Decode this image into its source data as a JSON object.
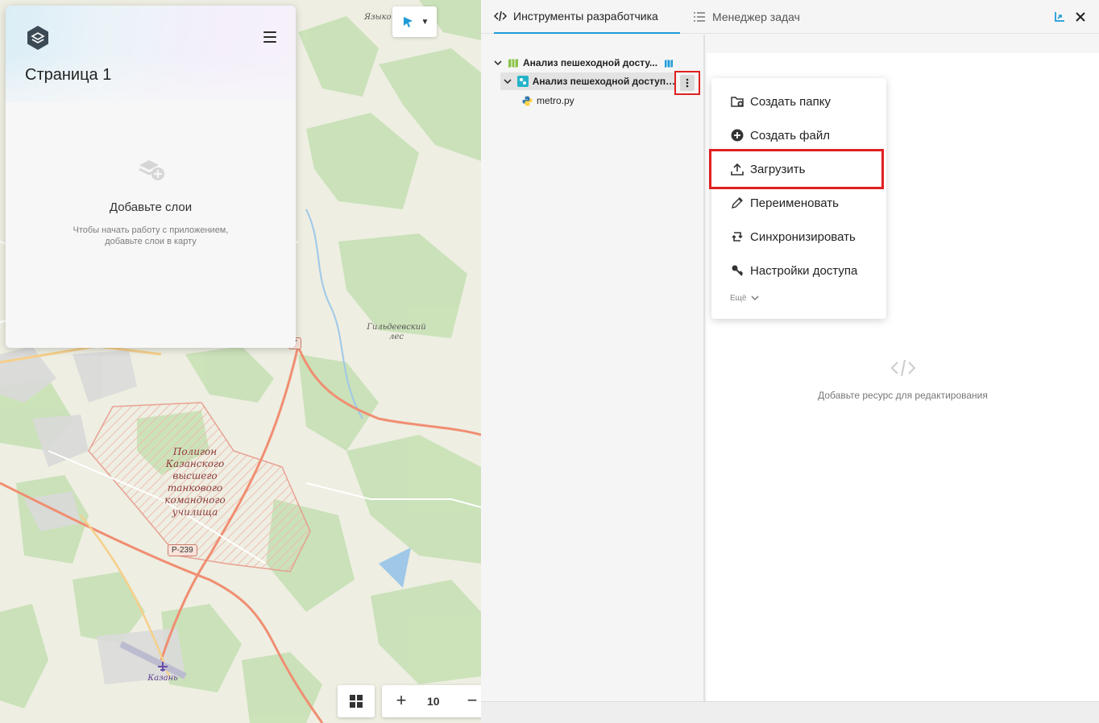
{
  "map": {
    "labels": {
      "polygon": "Полигон Казанского высшего танкового командного училища",
      "forest": "Гильдеевский лес",
      "town_top": "Языко",
      "airport": "Казань",
      "road_shield": "Р-239",
      "road_shield2": "7"
    }
  },
  "layers_card": {
    "page_title": "Страница 1",
    "empty_title": "Добавьте слои",
    "empty_subtitle": "Чтобы начать работу с приложением, добавьте слои в карту"
  },
  "map_controls": {
    "zoom_level": "10",
    "zoom_in_symbol": "+",
    "zoom_out_symbol": "−",
    "select_caret": "▼"
  },
  "dev_panel": {
    "tabs": [
      {
        "label": "Инструменты разработчика",
        "icon": "code-icon",
        "active": true
      },
      {
        "label": "Менеджер задач",
        "icon": "list-icon",
        "active": false
      }
    ],
    "tree": [
      {
        "label": "Анализ пешеходной досту...",
        "icon": "map-icon",
        "level": 0
      },
      {
        "label": "Анализ пешеходной доступн...",
        "icon": "package-icon",
        "level": 1
      },
      {
        "label": "metro.py",
        "icon": "python-icon",
        "level": 2
      }
    ],
    "editor_empty_text": "Добавьте ресурс для редактирования"
  },
  "context_menu": {
    "items": [
      {
        "label": "Создать папку",
        "icon": "folder-plus-icon"
      },
      {
        "label": "Создать файл",
        "icon": "plus-circle-icon"
      },
      {
        "label": "Загрузить",
        "icon": "upload-icon"
      },
      {
        "label": "Переименовать",
        "icon": "pencil-icon"
      },
      {
        "label": "Синхронизировать",
        "icon": "sync-icon"
      },
      {
        "label": "Настройки доступа",
        "icon": "key-icon"
      }
    ],
    "more_label": "Ещё"
  },
  "colors": {
    "accent": "#1e9bd7",
    "highlight": "#e02020"
  }
}
